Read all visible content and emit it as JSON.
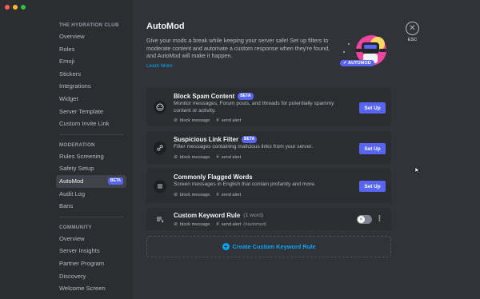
{
  "sidebar": {
    "sections": [
      {
        "header": "THE HYDRATION CLUB",
        "items": [
          {
            "label": "Overview"
          },
          {
            "label": "Roles"
          },
          {
            "label": "Emoji"
          },
          {
            "label": "Stickers"
          },
          {
            "label": "Integrations"
          },
          {
            "label": "Widget"
          },
          {
            "label": "Server Template"
          },
          {
            "label": "Custom Invite Link"
          }
        ]
      },
      {
        "header": "MODERATION",
        "items": [
          {
            "label": "Rules Screening"
          },
          {
            "label": "Safety Setup"
          },
          {
            "label": "AutoMod",
            "badge": "BETA",
            "active": true
          },
          {
            "label": "Audit Log"
          },
          {
            "label": "Bans"
          }
        ]
      },
      {
        "header": "COMMUNITY",
        "items": [
          {
            "label": "Overview"
          },
          {
            "label": "Server Insights"
          },
          {
            "label": "Partner Program"
          },
          {
            "label": "Discovery"
          },
          {
            "label": "Welcome Screen"
          }
        ]
      }
    ]
  },
  "main": {
    "title": "AutoMod",
    "description": "Give your mods a break while keeping your server safe! Set up filters to moderate content and automate a custom response when they're found, and AutoMod will make it happen.",
    "learn_more": "Learn More",
    "hero_badge": "✔ AUTOMOD",
    "close_label": "ESC",
    "rules": [
      {
        "name": "Block Spam Content",
        "badge": "BETA",
        "description": "Monitor messages, Forum posts, and threads for potentially spammy content or activity.",
        "tags": [
          {
            "icon": "block-icon",
            "label": "block message"
          },
          {
            "icon": "hash-icon",
            "label": "send alert"
          }
        ],
        "button": "Set Up"
      },
      {
        "name": "Suspicious Link Filter",
        "badge": "BETA",
        "description": "Filter messages containing malicious links from your server.",
        "tags": [
          {
            "icon": "block-icon",
            "label": "block message"
          },
          {
            "icon": "hash-icon",
            "label": "send alert"
          }
        ],
        "button": "Set Up"
      },
      {
        "name": "Commonly Flagged Words",
        "badge": "",
        "description": "Screen messages in English that contain profanity and more.",
        "tags": [
          {
            "icon": "block-icon",
            "label": "block message"
          },
          {
            "icon": "hash-icon",
            "label": "send alert"
          }
        ],
        "button": "Set Up"
      },
      {
        "name": "Custom Keyword Rule",
        "sub": "(1 word)",
        "tags": [
          {
            "icon": "block-icon",
            "label": "block message"
          },
          {
            "icon": "hash-icon",
            "label": "send alert",
            "extra": "(#automod)"
          }
        ],
        "enabled": false
      }
    ],
    "create_rule": "Create Custom Keyword Rule"
  },
  "colors": {
    "accent": "#5865f2",
    "link": "#00a8fc",
    "background": "#313338",
    "sidebar": "#2b2d31"
  }
}
